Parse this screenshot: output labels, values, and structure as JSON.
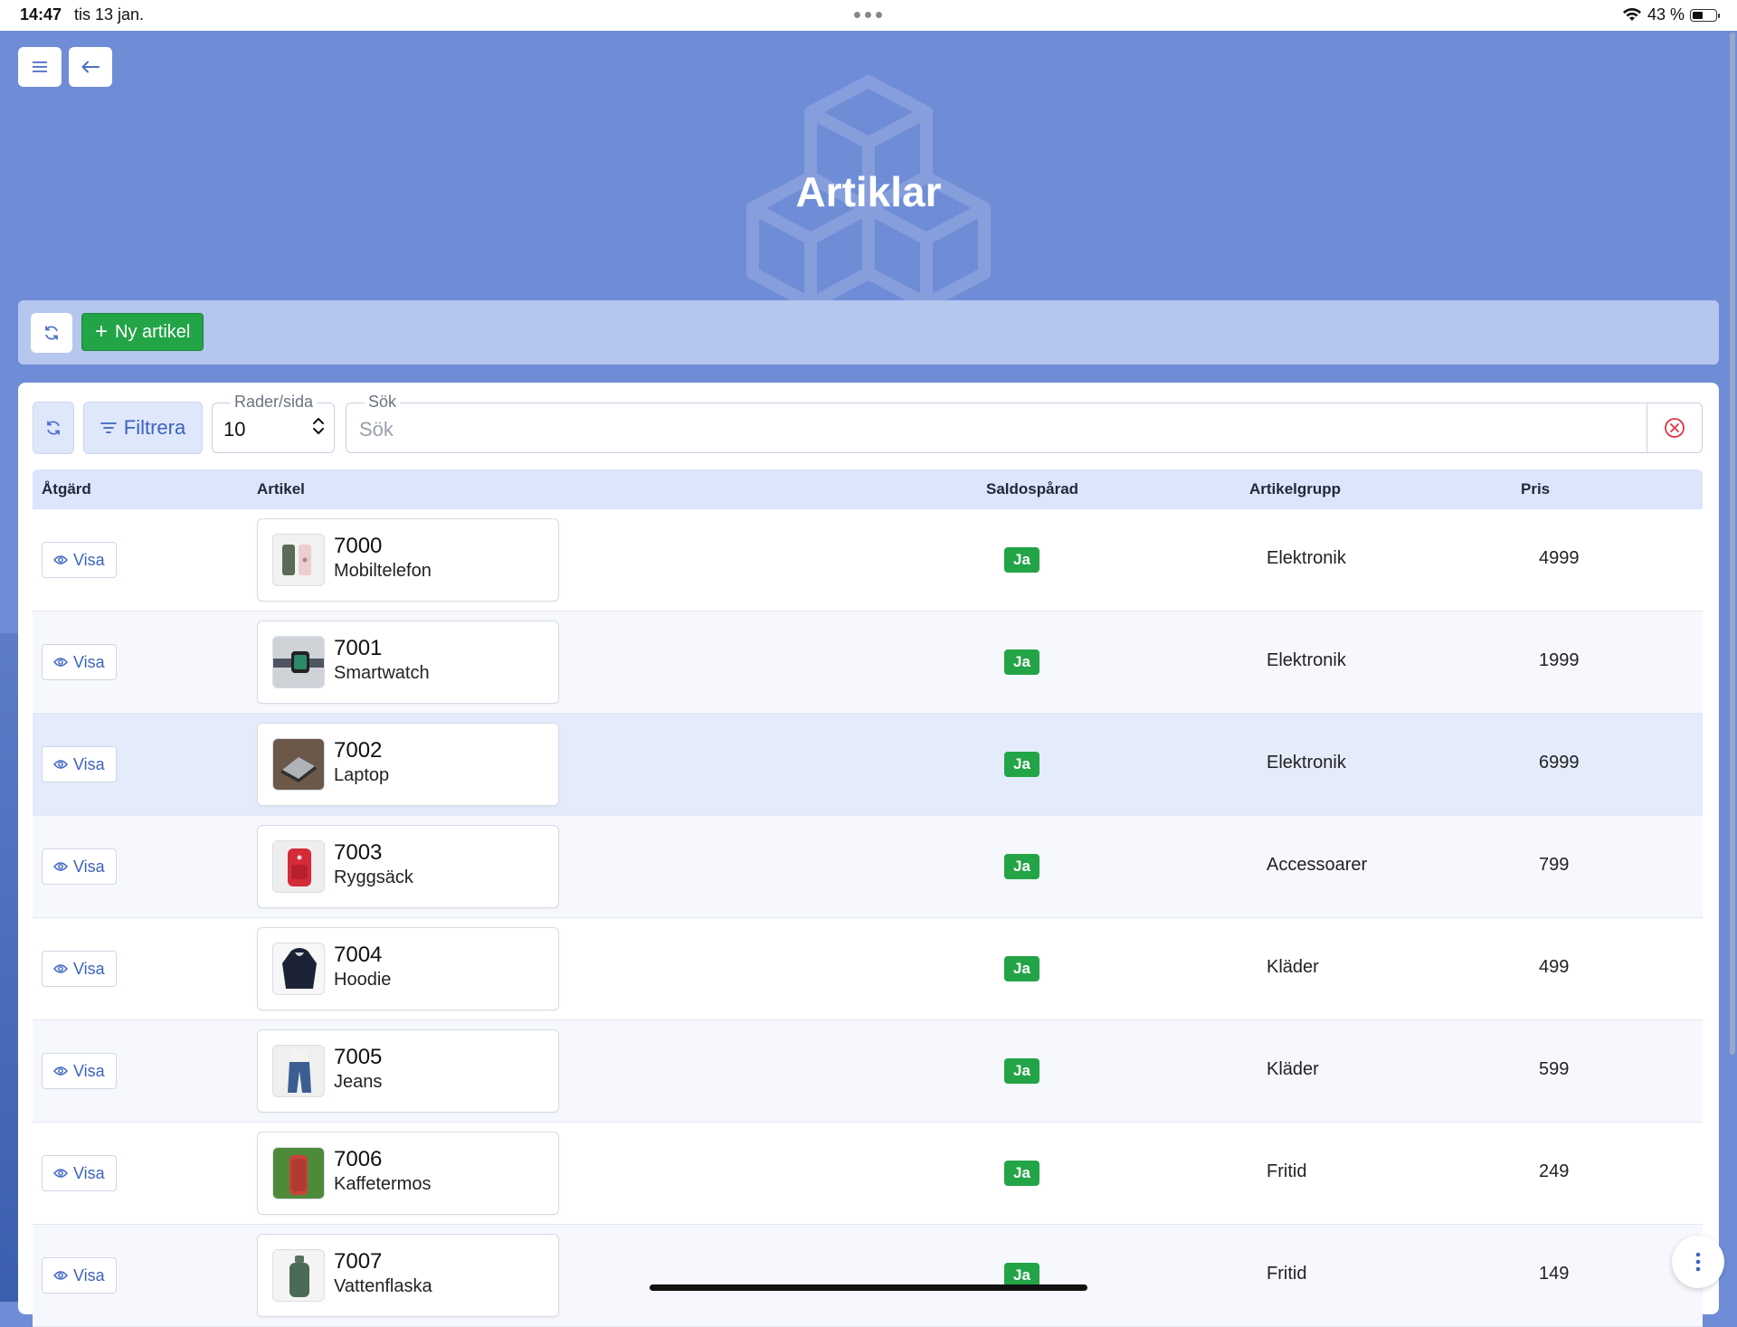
{
  "status_bar": {
    "time": "14:47",
    "date": "tis 13 jan.",
    "battery": "43 %"
  },
  "header": {
    "title": "Artiklar"
  },
  "actions": {
    "new_article": "Ny artikel"
  },
  "filters": {
    "filter_label": "Filtrera",
    "rows_per_page_label": "Rader/sida",
    "rows_per_page_value": "10",
    "search_label": "Sök",
    "search_placeholder": "Sök"
  },
  "table": {
    "columns": [
      "Åtgärd",
      "Artikel",
      "Saldospårad",
      "Artikelgrupp",
      "Pris"
    ],
    "rows": [
      {
        "action": "Visa",
        "code": "7000",
        "name": "Mobiltelefon",
        "tracked": "Ja",
        "group": "Elektronik",
        "price": "4999",
        "thumb": "phone"
      },
      {
        "action": "Visa",
        "code": "7001",
        "name": "Smartwatch",
        "tracked": "Ja",
        "group": "Elektronik",
        "price": "1999",
        "thumb": "watch"
      },
      {
        "action": "Visa",
        "code": "7002",
        "name": "Laptop",
        "tracked": "Ja",
        "group": "Elektronik",
        "price": "6999",
        "thumb": "laptop"
      },
      {
        "action": "Visa",
        "code": "7003",
        "name": "Ryggsäck",
        "tracked": "Ja",
        "group": "Accessoarer",
        "price": "799",
        "thumb": "backpack"
      },
      {
        "action": "Visa",
        "code": "7004",
        "name": "Hoodie",
        "tracked": "Ja",
        "group": "Kläder",
        "price": "499",
        "thumb": "hoodie"
      },
      {
        "action": "Visa",
        "code": "7005",
        "name": "Jeans",
        "tracked": "Ja",
        "group": "Kläder",
        "price": "599",
        "thumb": "jeans"
      },
      {
        "action": "Visa",
        "code": "7006",
        "name": "Kaffetermos",
        "tracked": "Ja",
        "group": "Fritid",
        "price": "249",
        "thumb": "thermos"
      },
      {
        "action": "Visa",
        "code": "7007",
        "name": "Vattenflaska",
        "tracked": "Ja",
        "group": "Fritid",
        "price": "149",
        "thumb": "bottle"
      }
    ]
  },
  "colors": {
    "primary": "#3b63c0",
    "success": "#22a447",
    "header_bg": "#6f8dd6",
    "action_bar": "#b5c6ef",
    "table_head": "#dbe5fb"
  }
}
